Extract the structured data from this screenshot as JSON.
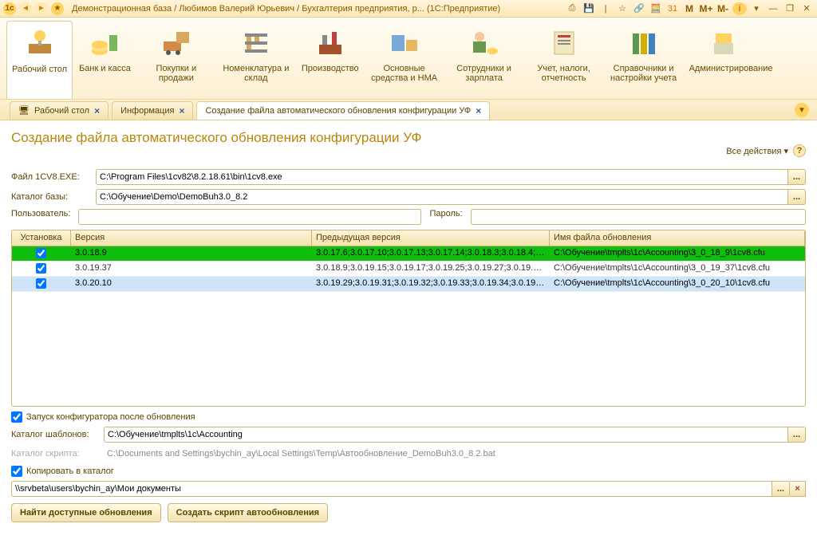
{
  "titlebar": {
    "title": "Демонстрационная база / Любимов Валерий Юрьевич / Бухгалтерия предприятия, р...  (1С:Предприятие)",
    "m": "M",
    "m_plus": "M+",
    "m_minus": "M-"
  },
  "ribbon": [
    {
      "label": "Рабочий\nстол",
      "id": "desktop"
    },
    {
      "label": "Банк и\nкасса",
      "id": "bank"
    },
    {
      "label": "Покупки и\nпродажи",
      "id": "sales"
    },
    {
      "label": "Номенклатура\nи склад",
      "id": "stock"
    },
    {
      "label": "Производство",
      "id": "prod"
    },
    {
      "label": "Основные\nсредства и НМА",
      "id": "assets"
    },
    {
      "label": "Сотрудники\nи зарплата",
      "id": "staff"
    },
    {
      "label": "Учет, налоги,\nотчетность",
      "id": "tax"
    },
    {
      "label": "Справочники и\nнастройки учета",
      "id": "refs"
    },
    {
      "label": "Администрирование",
      "id": "admin"
    }
  ],
  "tabs": {
    "t0": "Рабочий стол",
    "t1": "Информация",
    "t2": "Создание файла автоматического обновления конфигурации УФ"
  },
  "page": {
    "title": "Создание файла автоматического обновления конфигурации УФ",
    "all_actions": "Все действия",
    "labels": {
      "file": "Файл 1CV8.EXE:",
      "base": "Каталог базы:",
      "user": "Пользователь:",
      "password": "Пароль:",
      "tmpl": "Каталог шаблонов:",
      "script": "Каталог скрипта:",
      "run_after": "Запуск конфигуратора после обновления",
      "copy_to": "Копировать в каталог"
    },
    "values": {
      "file": "C:\\Program Files\\1cv82\\8.2.18.61\\bin\\1cv8.exe",
      "base": "C:\\Обучение\\Demo\\DemoBuh3.0_8.2",
      "user": "",
      "password": "",
      "tmpl": "C:\\Обучение\\tmplts\\1c\\Accounting",
      "script": "C:\\Documents and Settings\\bychin_ay\\Local Settings\\Temp\\Автообновление_DemoBuh3.0_8.2.bat",
      "copy_to": "\\\\srvbeta\\users\\bychin_ay\\Мои документы",
      "run_after_checked": true,
      "copy_to_checked": true
    },
    "grid": {
      "headers": {
        "inst": "Установка",
        "ver": "Версия",
        "prev": "Предыдущая версия",
        "file": "Имя файла обновления"
      },
      "rows": [
        {
          "checked": true,
          "ver": "3.0.18.9",
          "prev": "3.0.17.6;3.0.17.10;3.0.17.13;3.0.17.14;3.0.18.3;3.0.18.4;3...",
          "file": "C:\\Обучение\\tmplts\\1c\\Accounting\\3_0_18_9\\1cv8.cfu"
        },
        {
          "checked": true,
          "ver": "3.0.19.37",
          "prev": "3.0.18.9;3.0.19.15;3.0.19.17;3.0.19.25;3.0.19.27;3.0.19.29;...",
          "file": "C:\\Обучение\\tmplts\\1c\\Accounting\\3_0_19_37\\1cv8.cfu"
        },
        {
          "checked": true,
          "ver": "3.0.20.10",
          "prev": "3.0.19.29;3.0.19.31;3.0.19.32;3.0.19.33;3.0.19.34;3.0.19.3...",
          "file": "C:\\Обучение\\tmplts\\1c\\Accounting\\3_0_20_10\\1cv8.cfu"
        }
      ]
    },
    "buttons": {
      "find": "Найти доступные обновления",
      "create": "Создать скрипт автообновления"
    }
  }
}
